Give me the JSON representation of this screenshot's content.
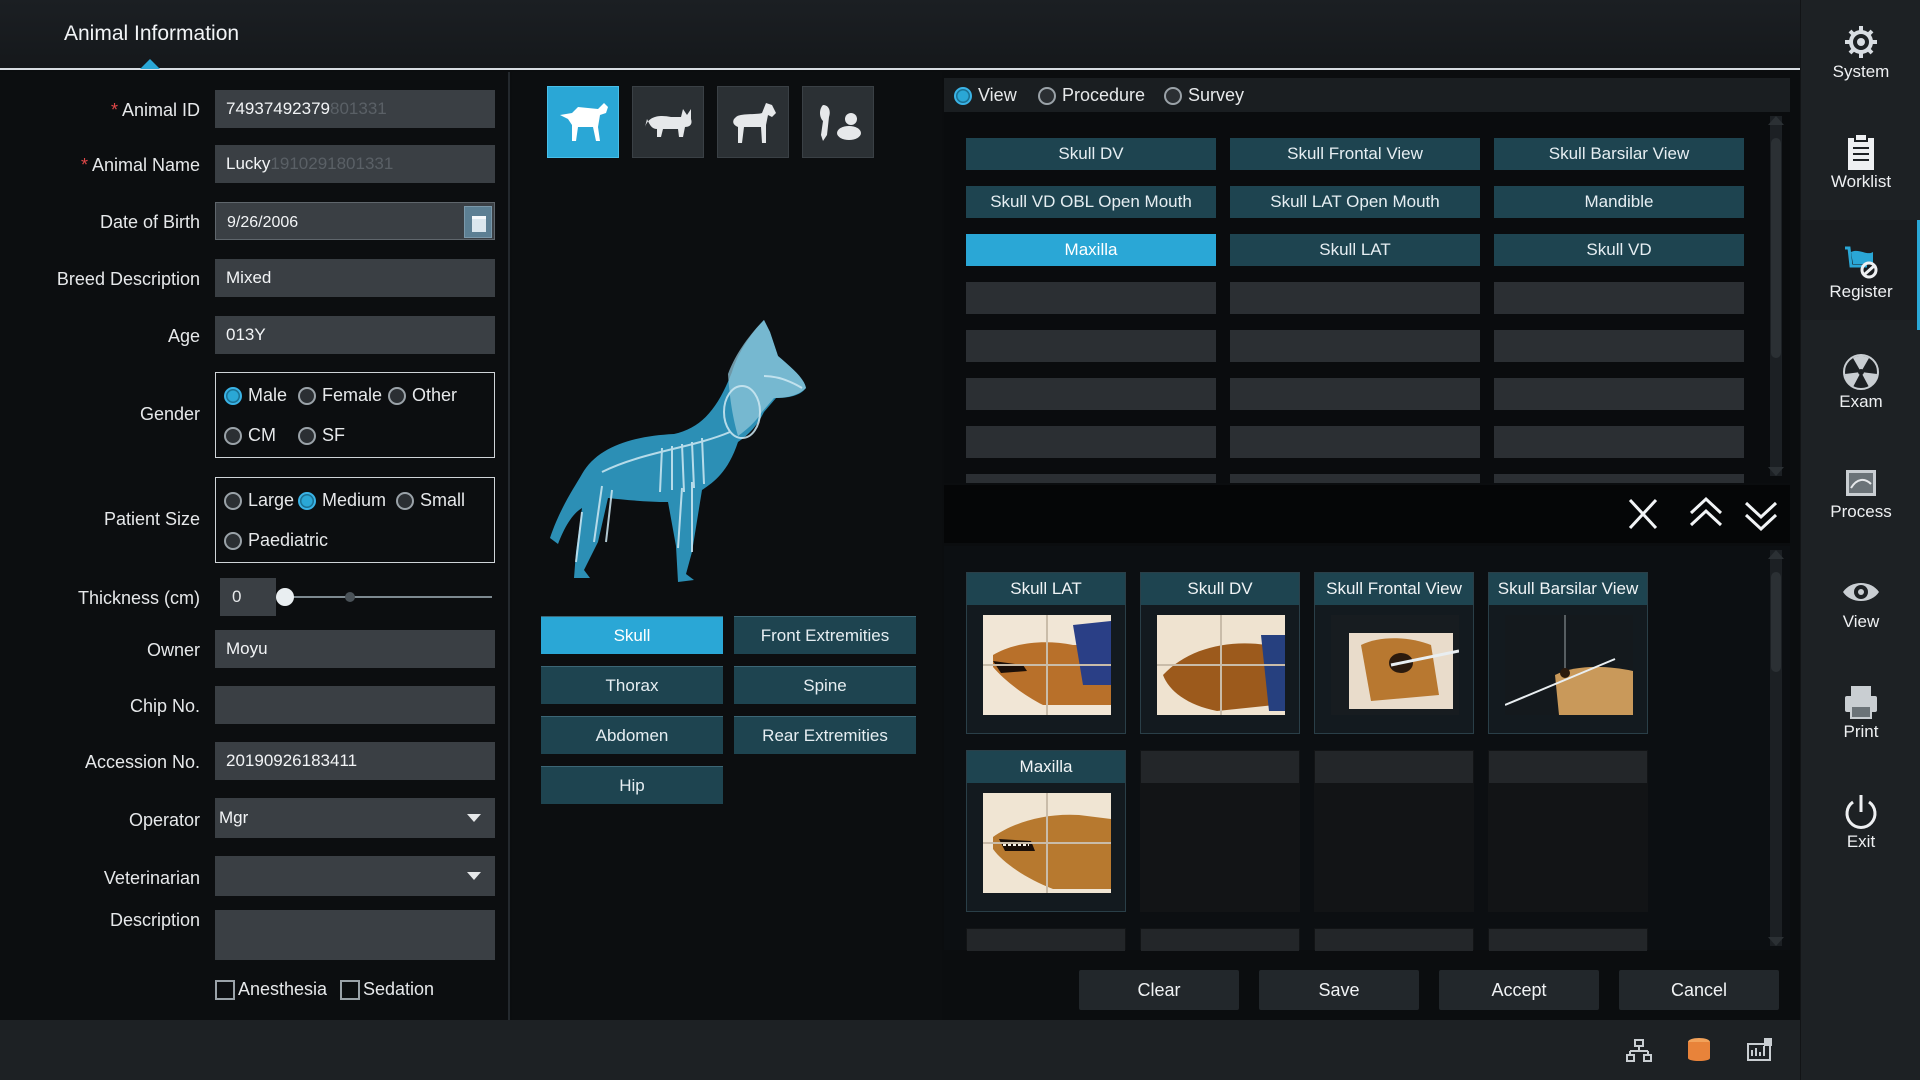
{
  "header": {
    "title": "Animal Information"
  },
  "form": {
    "animal_id": {
      "label": "Animal ID",
      "value": "74937492379",
      "ghost": "801331"
    },
    "animal_name": {
      "label": "Animal Name",
      "value": "Lucky",
      "ghost": "1910291801331"
    },
    "dob": {
      "label": "Date of Birth",
      "value": "9/26/2006"
    },
    "breed": {
      "label": "Breed Description",
      "value": "Mixed"
    },
    "age": {
      "label": "Age",
      "value": "013Y"
    },
    "gender": {
      "label": "Gender",
      "options": [
        "Male",
        "Female",
        "Other",
        "CM",
        "SF"
      ],
      "selected": "Male"
    },
    "patient_size": {
      "label": "Patient Size",
      "options": [
        "Large",
        "Medium",
        "Small",
        "Paediatric"
      ],
      "selected": "Medium"
    },
    "thickness": {
      "label": "Thickness (cm)",
      "value": "0"
    },
    "owner": {
      "label": "Owner",
      "value": "Moyu"
    },
    "chip": {
      "label": "Chip No.",
      "value": ""
    },
    "accession": {
      "label": "Accession No.",
      "value": "20190926183411"
    },
    "operator": {
      "label": "Operator",
      "value": "Mgr"
    },
    "veterinarian": {
      "label": "Veterinarian",
      "value": ""
    },
    "description": {
      "label": "Description",
      "value": ""
    },
    "checks": {
      "anesthesia": "Anesthesia",
      "sedation": "Sedation"
    }
  },
  "species": [
    "dog-icon",
    "cat-icon",
    "horse-icon",
    "exotic-icon"
  ],
  "regions": [
    {
      "label": "Skull",
      "active": true
    },
    {
      "label": "Front Extremities",
      "active": false
    },
    {
      "label": "Thorax",
      "active": false
    },
    {
      "label": "Spine",
      "active": false
    },
    {
      "label": "Abdomen",
      "active": false
    },
    {
      "label": "Rear Extremities",
      "active": false
    },
    {
      "label": "Hip",
      "active": false
    }
  ],
  "tabs": {
    "options": [
      "View",
      "Procedure",
      "Survey"
    ],
    "selected": "View"
  },
  "views": [
    {
      "label": "Skull DV",
      "active": false
    },
    {
      "label": "Skull Frontal View",
      "active": false
    },
    {
      "label": "Skull Barsilar View",
      "active": false
    },
    {
      "label": "Skull VD OBL Open Mouth",
      "active": false
    },
    {
      "label": "Skull LAT Open Mouth",
      "active": false
    },
    {
      "label": "Mandible",
      "active": false
    },
    {
      "label": "Maxilla",
      "active": true
    },
    {
      "label": "Skull LAT",
      "active": false
    },
    {
      "label": "Skull VD",
      "active": false
    }
  ],
  "selected_views": [
    "Skull LAT",
    "Skull DV",
    "Skull Frontal View",
    "Skull Barsilar View",
    "Maxilla"
  ],
  "actions": {
    "clear": "Clear",
    "save": "Save",
    "accept": "Accept",
    "cancel": "Cancel"
  },
  "nav": [
    {
      "label": "System",
      "icon": "gear-icon"
    },
    {
      "label": "Worklist",
      "icon": "clipboard-icon"
    },
    {
      "label": "Register",
      "icon": "register-icon",
      "selected": true
    },
    {
      "label": "Exam",
      "icon": "radiation-icon"
    },
    {
      "label": "Process",
      "icon": "image-process-icon"
    },
    {
      "label": "View",
      "icon": "eye-icon"
    },
    {
      "label": "Print",
      "icon": "printer-icon"
    },
    {
      "label": "Exit",
      "icon": "power-icon"
    }
  ],
  "colors": {
    "accent": "#2aa7d6",
    "button": "#1e4450",
    "required": "#e04848"
  }
}
